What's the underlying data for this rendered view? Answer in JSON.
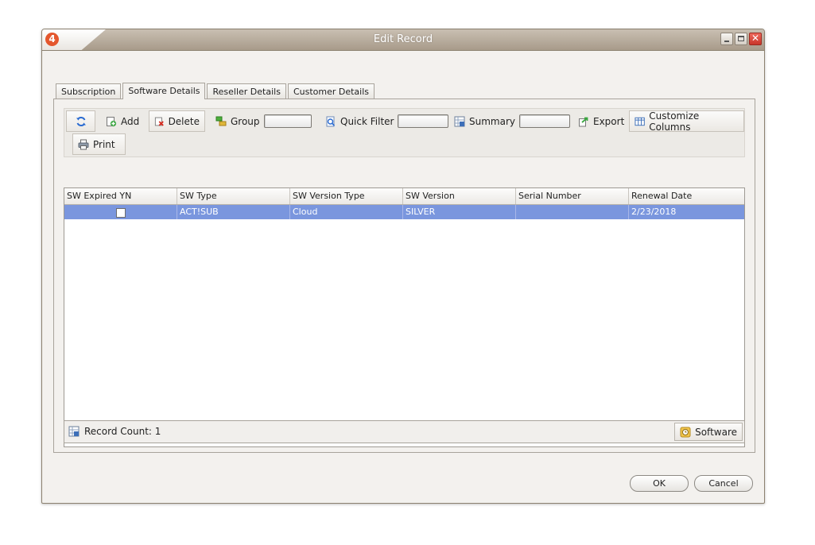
{
  "window": {
    "title": "Edit Record",
    "app_icon_label": "4"
  },
  "tabs": [
    {
      "label": "Subscription"
    },
    {
      "label": "Software Details",
      "active": true
    },
    {
      "label": "Reseller Details"
    },
    {
      "label": "Customer Details"
    }
  ],
  "toolbar": {
    "add_label": "Add",
    "delete_label": "Delete",
    "group_label": "Group",
    "quick_filter_label": "Quick Filter",
    "summary_label": "Summary",
    "export_label": "Export",
    "customize_columns_label": "Customize Columns",
    "print_label": "Print"
  },
  "grid": {
    "columns": [
      "SW Expired YN",
      "SW Type",
      "SW Version Type",
      "SW Version",
      "Serial Number",
      "Renewal Date"
    ],
    "rows": [
      {
        "sw_expired_yn": false,
        "sw_type": "ACT!SUB",
        "sw_version_type": "Cloud",
        "sw_version": "SILVER",
        "serial_number": "",
        "renewal_date": "2/23/2018"
      }
    ],
    "selected_row_color": "#7a96de"
  },
  "status": {
    "record_count": "Record Count: 1",
    "software_button_label": "Software"
  },
  "buttons": {
    "ok_label": "OK",
    "cancel_label": "Cancel"
  }
}
